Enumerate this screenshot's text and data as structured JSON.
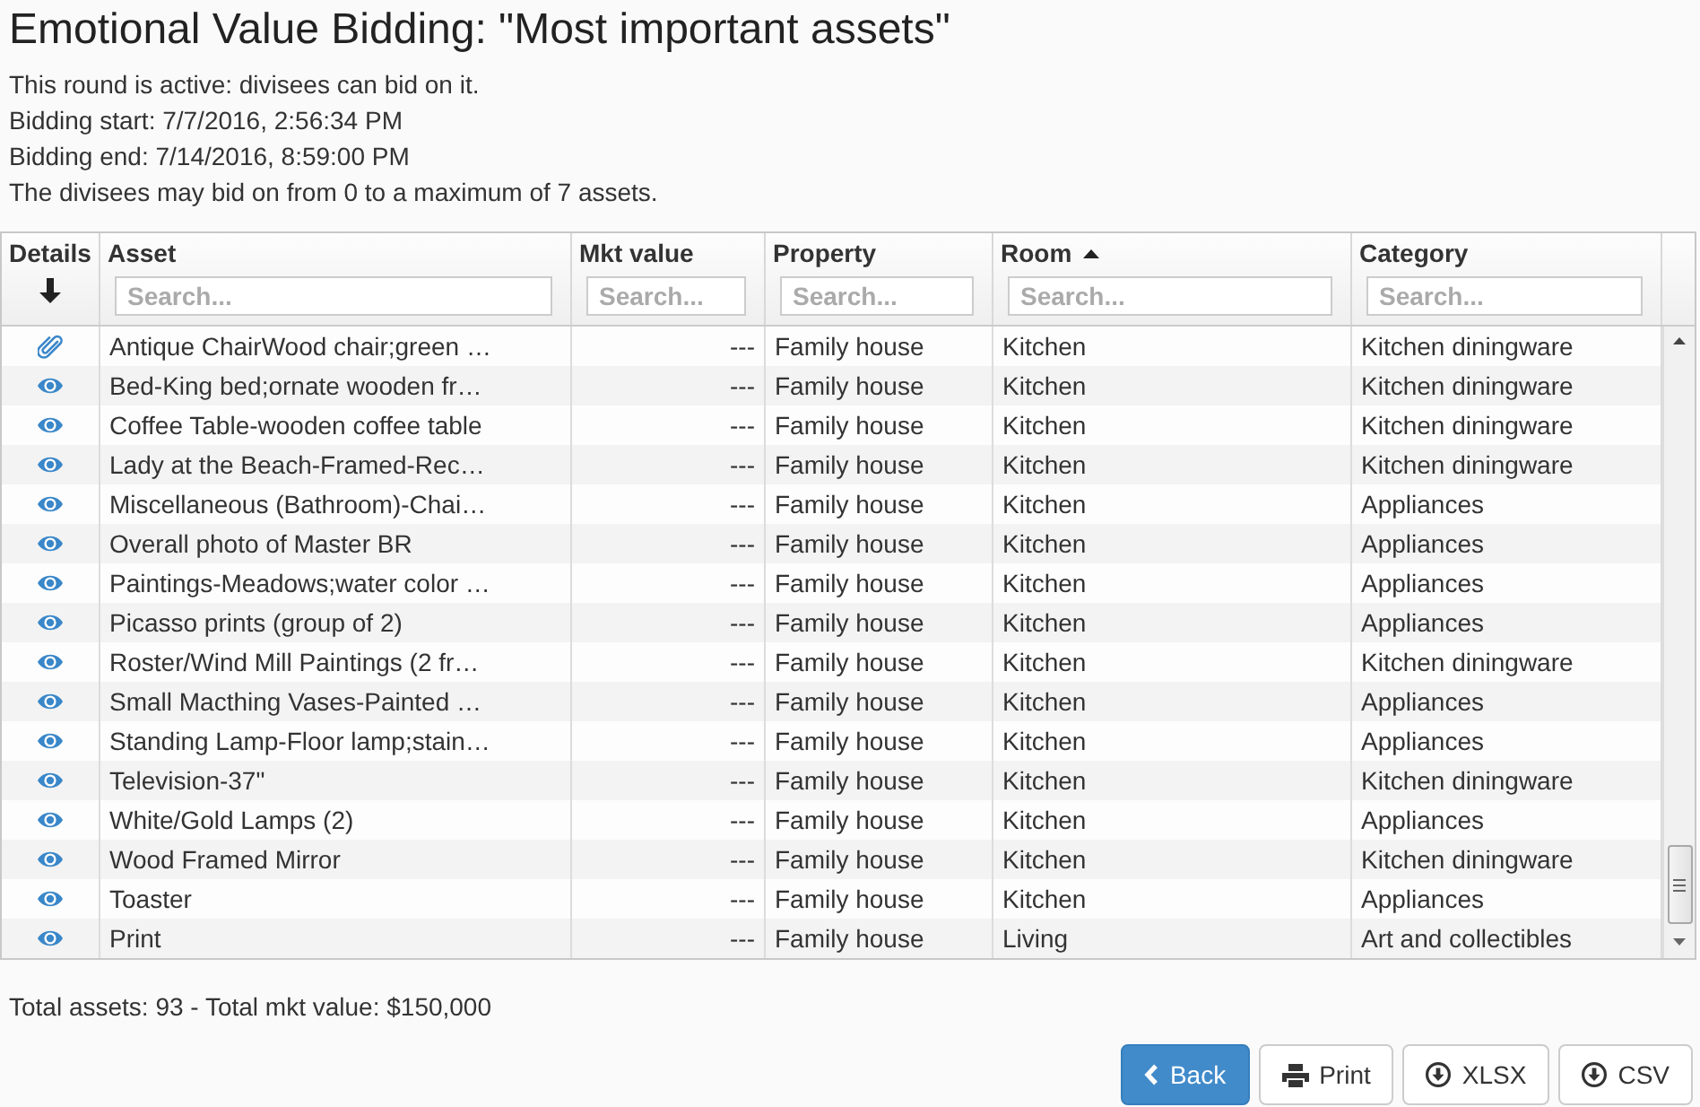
{
  "title": "Emotional Value Bidding: \"Most important assets\"",
  "info": [
    "This round is active: divisees can bid on it.",
    "Bidding start: 7/7/2016, 2:56:34 PM",
    "Bidding end: 7/14/2016, 8:59:00 PM",
    "The divisees may bid on from 0 to a maximum of 7 assets."
  ],
  "table": {
    "columns": [
      {
        "label": "Details",
        "kind": "icon",
        "sorted": false
      },
      {
        "label": "Asset",
        "kind": "text",
        "sorted": false,
        "placeholder": "Search..."
      },
      {
        "label": "Mkt value",
        "kind": "number",
        "sorted": false,
        "placeholder": "Search..."
      },
      {
        "label": "Property",
        "kind": "text",
        "sorted": false,
        "placeholder": "Search..."
      },
      {
        "label": "Room",
        "kind": "text",
        "sorted": true,
        "placeholder": "Search..."
      },
      {
        "label": "Category",
        "kind": "text",
        "sorted": false,
        "placeholder": "Search..."
      }
    ],
    "rows": [
      {
        "kind": "attachment",
        "cells": [
          "",
          "Antique ChairWood chair;green …",
          "---",
          "Family house",
          "Kitchen",
          "Kitchen diningware"
        ]
      },
      {
        "kind": "view",
        "cells": [
          "",
          "Bed-King bed;ornate wooden fr…",
          "---",
          "Family house",
          "Kitchen",
          "Kitchen diningware"
        ]
      },
      {
        "kind": "view",
        "cells": [
          "",
          "Coffee Table-wooden coffee table",
          "---",
          "Family house",
          "Kitchen",
          "Kitchen diningware"
        ]
      },
      {
        "kind": "view",
        "cells": [
          "",
          "Lady at the Beach-Framed-Rec…",
          "---",
          "Family house",
          "Kitchen",
          "Kitchen diningware"
        ]
      },
      {
        "kind": "view",
        "cells": [
          "",
          "Miscellaneous (Bathroom)-Chai…",
          "---",
          "Family house",
          "Kitchen",
          "Appliances"
        ]
      },
      {
        "kind": "view",
        "cells": [
          "",
          "Overall photo of Master BR",
          "---",
          "Family house",
          "Kitchen",
          "Appliances"
        ]
      },
      {
        "kind": "view",
        "cells": [
          "",
          "Paintings-Meadows;water color …",
          "---",
          "Family house",
          "Kitchen",
          "Appliances"
        ]
      },
      {
        "kind": "view",
        "cells": [
          "",
          "Picasso prints (group of 2)",
          "---",
          "Family house",
          "Kitchen",
          "Appliances"
        ]
      },
      {
        "kind": "view",
        "cells": [
          "",
          "Roster/Wind Mill Paintings (2 fr…",
          "---",
          "Family house",
          "Kitchen",
          "Kitchen diningware"
        ]
      },
      {
        "kind": "view",
        "cells": [
          "",
          "Small Macthing Vases-Painted …",
          "---",
          "Family house",
          "Kitchen",
          "Appliances"
        ]
      },
      {
        "kind": "view",
        "cells": [
          "",
          "Standing Lamp-Floor lamp;stain…",
          "---",
          "Family house",
          "Kitchen",
          "Appliances"
        ]
      },
      {
        "kind": "view",
        "cells": [
          "",
          "Television-37\"",
          "---",
          "Family house",
          "Kitchen",
          "Kitchen diningware"
        ]
      },
      {
        "kind": "view",
        "cells": [
          "",
          "White/Gold Lamps (2)",
          "---",
          "Family house",
          "Kitchen",
          "Appliances"
        ]
      },
      {
        "kind": "view",
        "cells": [
          "",
          "Wood Framed Mirror",
          "---",
          "Family house",
          "Kitchen",
          "Kitchen diningware"
        ]
      },
      {
        "kind": "view",
        "cells": [
          "",
          "Toaster",
          "---",
          "Family house",
          "Kitchen",
          "Appliances"
        ]
      },
      {
        "kind": "view",
        "cells": [
          "",
          "Print",
          "---",
          "Family house",
          "Living",
          "Art and collectibles"
        ]
      }
    ]
  },
  "summary": "Total assets: 93 - Total mkt value: $150,000",
  "buttons": [
    {
      "label": "Back",
      "kind": "back",
      "primary": true
    },
    {
      "label": "Print",
      "kind": "print",
      "primary": false
    },
    {
      "label": "XLSX",
      "kind": "download",
      "primary": false
    },
    {
      "label": "CSV",
      "kind": "download",
      "primary": false
    }
  ]
}
